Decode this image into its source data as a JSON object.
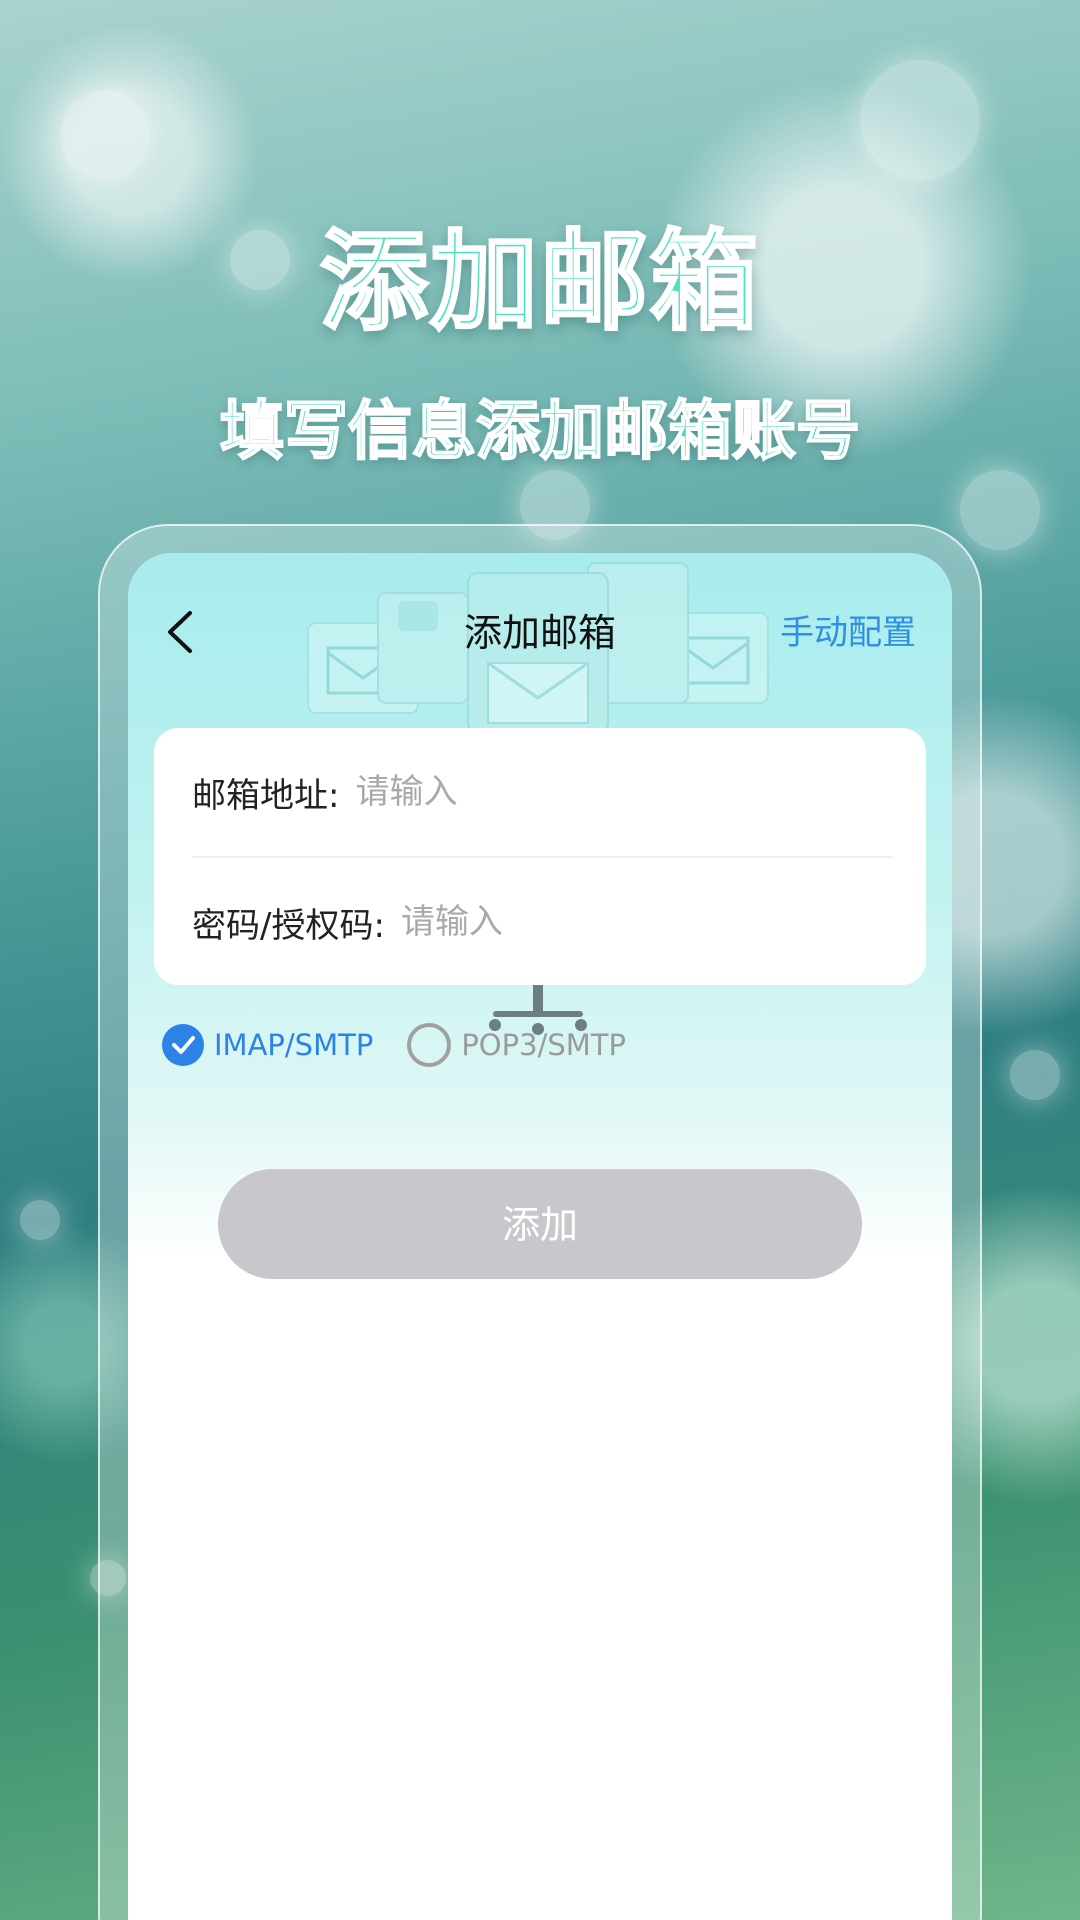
{
  "promo": {
    "title": "添加邮箱",
    "subtitle": "填写信息添加邮箱账号"
  },
  "nav": {
    "back_icon": "chevron-left-icon",
    "title": "添加邮箱",
    "manual_config": "手动配置"
  },
  "form": {
    "email": {
      "label": "邮箱地址:",
      "placeholder": "请输入",
      "value": ""
    },
    "password": {
      "label": "密码/授权码:",
      "placeholder": "请输入",
      "value": ""
    }
  },
  "protocols": [
    {
      "label": "IMAP/SMTP",
      "selected": true
    },
    {
      "label": "POP3/SMTP",
      "selected": false
    }
  ],
  "add_button": "添加",
  "colors": {
    "accent": "#2b83e6",
    "title_green": "#4fe0c3",
    "button_disabled": "#c8c7cc"
  }
}
